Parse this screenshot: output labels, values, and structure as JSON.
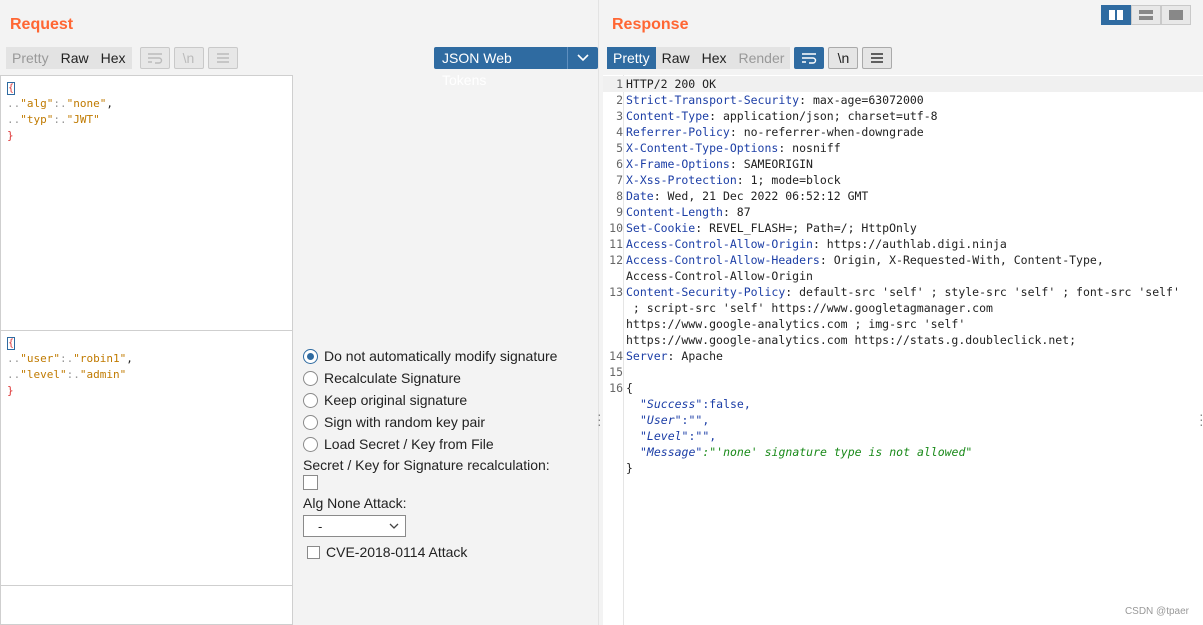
{
  "request": {
    "title": "Request",
    "tabs": [
      "Pretty",
      "Raw",
      "Hex"
    ],
    "jwt_dropdown": "JSON Web Tokens",
    "header_lines": [
      {
        "key": "\"alg\"",
        "val": "\"none\"",
        "comma": ","
      },
      {
        "key": "\"typ\"",
        "val": "\"JWT\"",
        "comma": ""
      }
    ],
    "payload_lines": [
      {
        "key": "\"user\"",
        "val": "\"robin1\"",
        "comma": ","
      },
      {
        "key": "\"level\"",
        "val": "\"admin\"",
        "comma": ""
      }
    ],
    "open_brace": "{",
    "close_brace": "}",
    "options": {
      "radios": [
        "Do not automatically modify signature",
        "Recalculate Signature",
        "Keep original signature",
        "Sign with random key pair",
        "Load Secret / Key from File"
      ],
      "secret_label": "Secret / Key for Signature recalculation:",
      "alg_none_label": "Alg None Attack:",
      "alg_none_value": "-",
      "cve_label": "CVE-2018-0114 Attack"
    }
  },
  "response": {
    "title": "Response",
    "tabs": [
      "Pretty",
      "Raw",
      "Hex",
      "Render"
    ],
    "lines": [
      {
        "n": "1",
        "k": "HTTP/2 200 OK",
        "v": ""
      },
      {
        "n": "2",
        "k": "Strict-Transport-Security",
        "v": ": max-age=63072000"
      },
      {
        "n": "3",
        "k": "Content-Type",
        "v": ": application/json; charset=utf-8"
      },
      {
        "n": "4",
        "k": "Referrer-Policy",
        "v": ": no-referrer-when-downgrade"
      },
      {
        "n": "5",
        "k": "X-Content-Type-Options",
        "v": ": nosniff"
      },
      {
        "n": "6",
        "k": "X-Frame-Options",
        "v": ": SAMEORIGIN"
      },
      {
        "n": "7",
        "k": "X-Xss-Protection",
        "v": ": 1; mode=block"
      },
      {
        "n": "8",
        "k": "Date",
        "v": ": Wed, 21 Dec 2022 06:52:12 GMT"
      },
      {
        "n": "9",
        "k": "Content-Length",
        "v": ": 87"
      },
      {
        "n": "10",
        "k": "Set-Cookie",
        "v": ": REVEL_FLASH=; Path=/; HttpOnly"
      },
      {
        "n": "11",
        "k": "Access-Control-Allow-Origin",
        "v": ": https://authlab.digi.ninja"
      },
      {
        "n": "12",
        "k": "Access-Control-Allow-Headers",
        "v": ": Origin, X-Requested-With, Content-Type,"
      },
      {
        "n": "",
        "k": "",
        "v": "Access-Control-Allow-Origin"
      },
      {
        "n": "13",
        "k": "Content-Security-Policy",
        "v": ": default-src 'self' ; style-src 'self' ; font-src 'self'"
      },
      {
        "n": "",
        "k": "",
        "v": " ; script-src 'self' https://www.googletagmanager.com"
      },
      {
        "n": "",
        "k": "",
        "v": "https://www.google-analytics.com ; img-src 'self'"
      },
      {
        "n": "",
        "k": "",
        "v": "https://www.google-analytics.com https://stats.g.doubleclick.net;"
      },
      {
        "n": "14",
        "k": "Server",
        "v": ": Apache"
      },
      {
        "n": "15",
        "k": "",
        "v": ""
      },
      {
        "n": "16",
        "k": "",
        "v": "{"
      }
    ],
    "json_body": [
      {
        "k": "\"Success\"",
        "v": ":false,",
        "str": false
      },
      {
        "k": "\"User\"",
        "v": ":\"\",",
        "str": false
      },
      {
        "k": "\"Level\"",
        "v": ":\"\",",
        "str": false
      },
      {
        "k": "\"Message\"",
        "v": ":\"'none' signature type is not allowed\"",
        "str": true
      }
    ],
    "json_close": "}"
  },
  "watermark": "CSDN @tpaer"
}
